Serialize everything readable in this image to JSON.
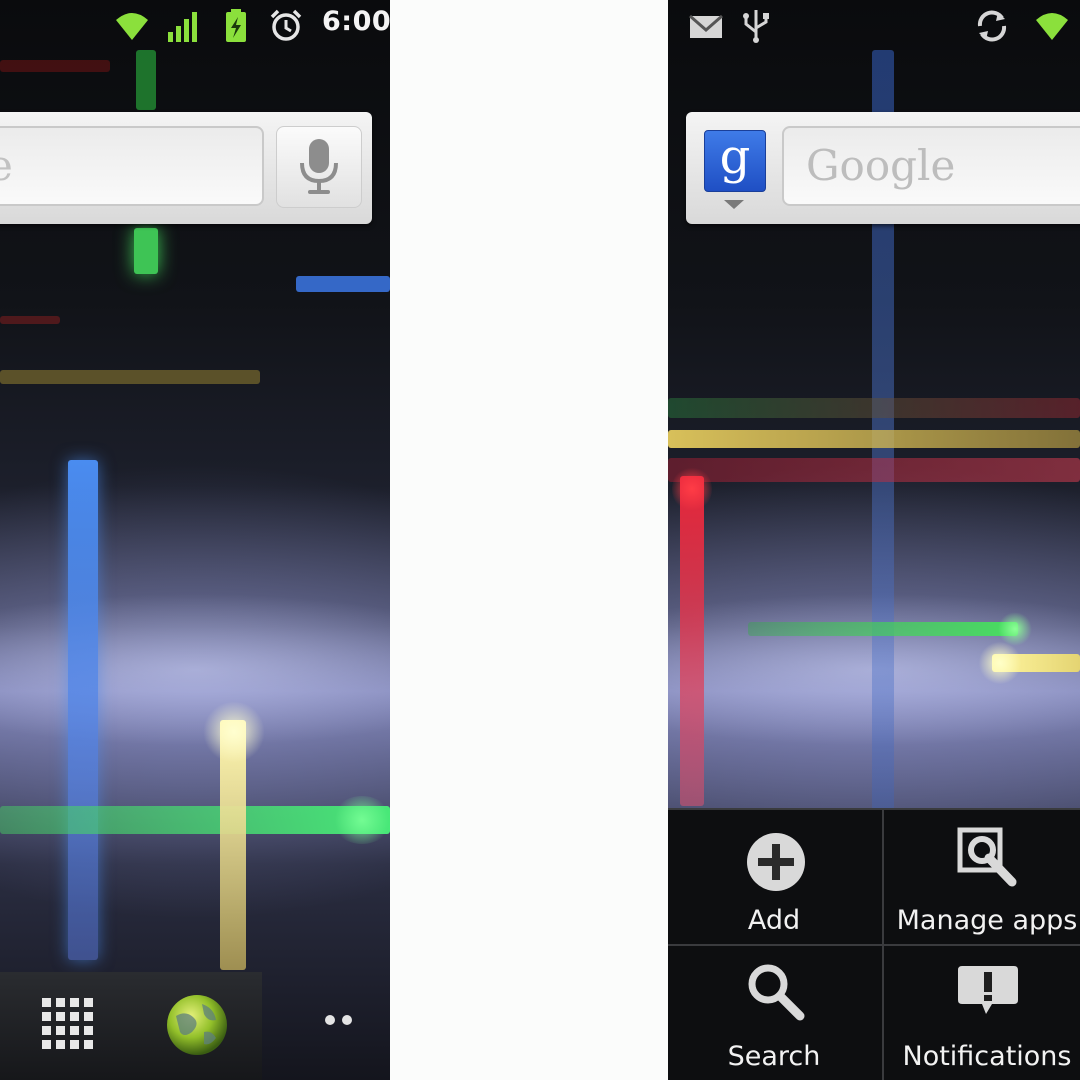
{
  "left_screen": {
    "status_bar": {
      "time": "6:00",
      "icons": [
        "wifi-icon",
        "signal-icon",
        "battery-icon",
        "alarm-icon"
      ]
    },
    "search_widget": {
      "field_text": "e",
      "voice_icon": "microphone-icon"
    },
    "dock": {
      "icons": [
        "app-drawer-icon",
        "browser-globe-icon",
        "page-dots-icon"
      ]
    }
  },
  "right_screen": {
    "status_bar": {
      "icons": [
        "gmail-icon",
        "usb-icon",
        "sync-icon",
        "wifi-icon"
      ]
    },
    "search_widget": {
      "logo_letter": "g",
      "field_placeholder": "Google"
    },
    "options_menu": {
      "items": [
        {
          "label": "Add",
          "icon": "add-icon"
        },
        {
          "label": "Manage apps",
          "icon": "manage-apps-icon"
        },
        {
          "label": "Search",
          "icon": "search-icon"
        },
        {
          "label": "Notifications",
          "icon": "notifications-icon"
        }
      ]
    }
  },
  "colors": {
    "beam_green": "#3ee860",
    "beam_blue": "#4a8cf0",
    "beam_red": "#e8283c",
    "beam_yellow": "#e8d86a",
    "google_blue": "#2f63d8"
  }
}
